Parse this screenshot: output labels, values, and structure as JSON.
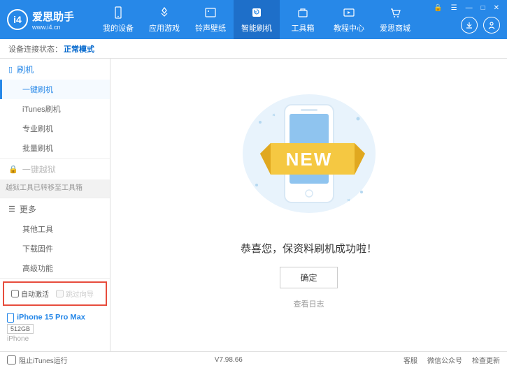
{
  "header": {
    "logo_title": "爱思助手",
    "logo_url": "www.i4.cn",
    "nav": [
      {
        "label": "我的设备"
      },
      {
        "label": "应用游戏"
      },
      {
        "label": "铃声壁纸"
      },
      {
        "label": "智能刷机"
      },
      {
        "label": "工具箱"
      },
      {
        "label": "教程中心"
      },
      {
        "label": "爱思商城"
      }
    ]
  },
  "status": {
    "label": "设备连接状态：",
    "mode": "正常模式"
  },
  "sidebar": {
    "flash": {
      "title": "刷机",
      "items": [
        "一键刷机",
        "iTunes刷机",
        "专业刷机",
        "批量刷机"
      ]
    },
    "jailbreak": {
      "title": "一键越狱",
      "info": "越狱工具已转移至工具箱"
    },
    "more": {
      "title": "更多",
      "items": [
        "其他工具",
        "下载固件",
        "高级功能"
      ]
    },
    "checkboxes": {
      "auto_activate": "自动激活",
      "skip_wizard": "跳过向导"
    },
    "device": {
      "name": "iPhone 15 Pro Max",
      "storage": "512GB",
      "type": "iPhone"
    }
  },
  "main": {
    "message": "恭喜您，保资料刷机成功啦！",
    "ok_button": "确定",
    "view_log": "查看日志",
    "new_badge": "NEW"
  },
  "footer": {
    "block_itunes": "阻止iTunes运行",
    "version": "V7.98.66",
    "links": [
      "客服",
      "微信公众号",
      "检查更新"
    ]
  }
}
